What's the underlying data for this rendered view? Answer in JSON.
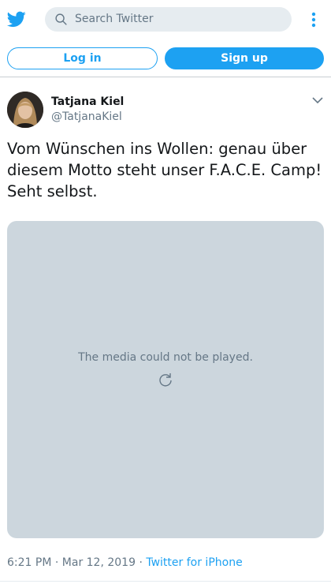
{
  "header": {
    "logo_icon": "twitter-bird-icon",
    "search_placeholder": "Search Twitter",
    "more_icon": "more-vertical-icon"
  },
  "auth": {
    "login_label": "Log in",
    "signup_label": "Sign up"
  },
  "tweet": {
    "author_name": "Tatjana Kiel",
    "author_handle": "@TatjanaKiel",
    "text": "Vom Wünschen ins Wollen: genau über diesem Motto steht unser F.A.C.E. Camp! Seht selbst.",
    "media_message": "The media could not be played.",
    "time": "6:21 PM",
    "separator": "·",
    "date": "Mar 12, 2019",
    "source": "Twitter for iPhone"
  },
  "colors": {
    "brand": "#1da1f2",
    "muted_text": "#657786",
    "media_bg": "#ccd6dd"
  }
}
